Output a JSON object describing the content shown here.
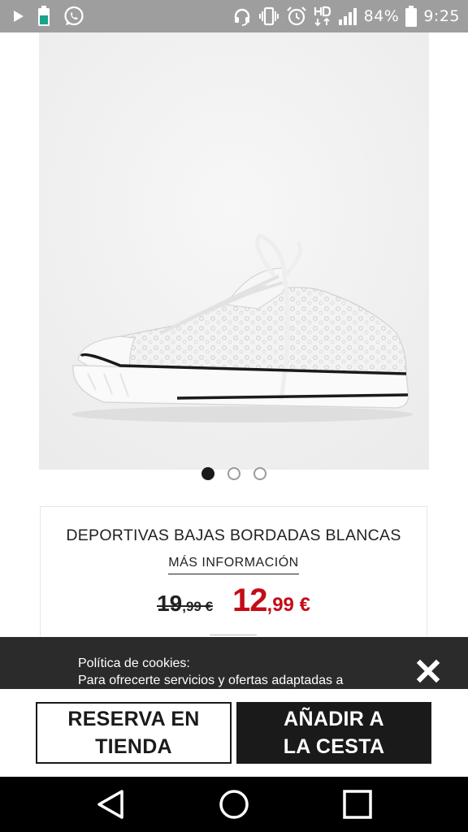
{
  "status_bar": {
    "battery_percent": "84%",
    "time": "9:25",
    "left_icons": [
      "play-icon",
      "battery-saver-icon",
      "whatsapp-icon"
    ],
    "right_icons": [
      "headset-icon",
      "vibrate-icon",
      "alarm-icon",
      "hd-icon",
      "signal-icon",
      "battery-icon"
    ]
  },
  "product": {
    "image_icon": "white-lace-sneaker-image",
    "carousel": {
      "count": 3,
      "active_index": 0
    },
    "title": "DEPORTIVAS BAJAS BORDADAS BLANCAS",
    "more_info": "MÁS INFORMACIÓN",
    "old_price": {
      "int": "19",
      "dec": ",99 €"
    },
    "new_price": {
      "int": "12",
      "dec": ",99 €"
    },
    "price_color": "#c40c16"
  },
  "cookie_banner": {
    "title": "Política de cookies:",
    "body": "Para ofrecerte servicios y ofertas adaptadas a",
    "close_icon": "close-icon"
  },
  "actions": {
    "reserve_label": "RESERVA EN\nTIENDA",
    "add_label": "AÑADIR A\nLA CESTA"
  },
  "nav_bar": {
    "items": [
      "back-icon",
      "home-icon",
      "recents-icon"
    ]
  }
}
